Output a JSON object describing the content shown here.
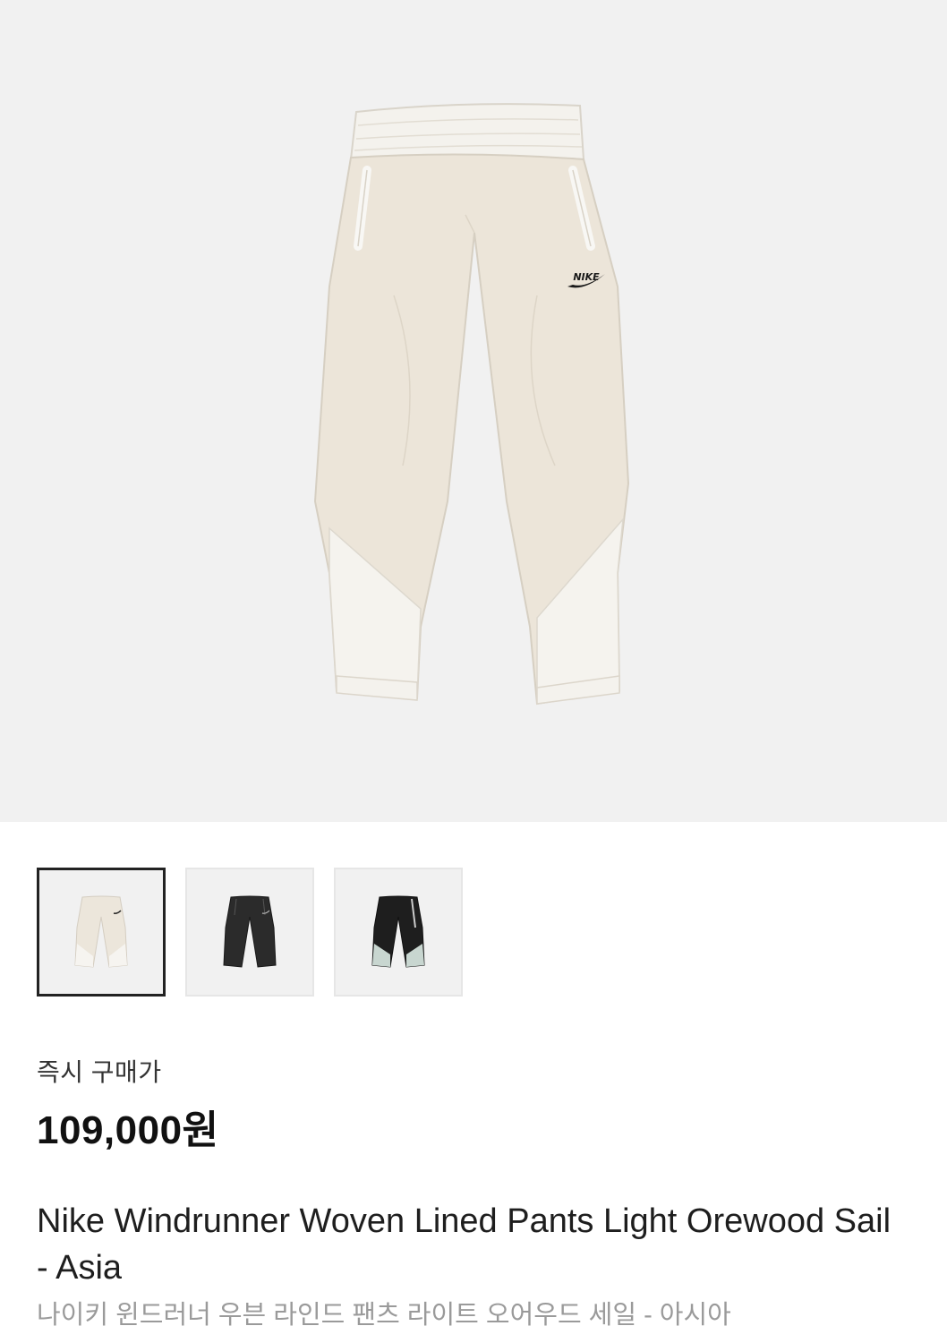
{
  "product": {
    "price_label": "즉시 구매가",
    "price": "109,000원",
    "name_en": "Nike Windrunner Woven Lined Pants Light Orewood Sail - Asia",
    "name_ko": "나이키 윈드러너 우븐 라인드 팬츠 라이트 오어우드 세일 - 아시아",
    "logo_text": "NIKE"
  },
  "gallery": {
    "thumbnails": [
      {
        "variant": "light-orewood-sail",
        "selected": true
      },
      {
        "variant": "black",
        "selected": false
      },
      {
        "variant": "black-grey",
        "selected": false
      }
    ]
  },
  "colors": {
    "hero_bg": "#f1f1f1",
    "pants_cream": "#ede7dc",
    "pants_light": "#f5f3ef",
    "pants_black": "#2a2a2a",
    "pants_grey": "#c8d4cf",
    "selected_border": "#222222"
  }
}
